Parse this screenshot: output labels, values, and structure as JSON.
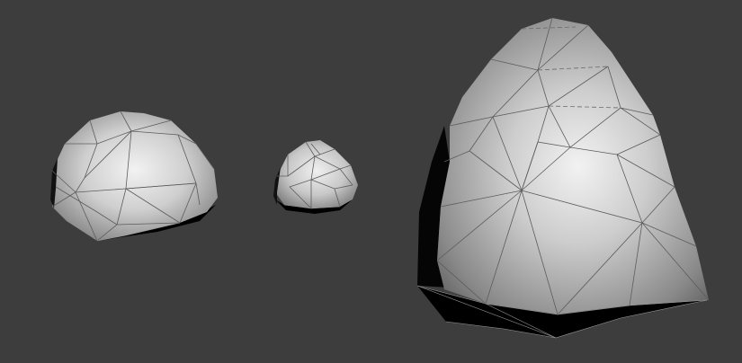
{
  "viewport": {
    "background_color": "#3d3d3d",
    "objects": [
      {
        "name": "rock-small-left",
        "kind": "low-poly rock mesh"
      },
      {
        "name": "rock-tiny-center",
        "kind": "low-poly rock mesh"
      },
      {
        "name": "rock-large-right",
        "kind": "low-poly rock mesh"
      }
    ],
    "colors": {
      "mesh_highlight": "#f2f2f2",
      "mesh_mid": "#bdbdbd",
      "mesh_shadow": "#6e6e6e",
      "mesh_dark": "#000000",
      "wireframe": "#5c5c5c"
    }
  }
}
